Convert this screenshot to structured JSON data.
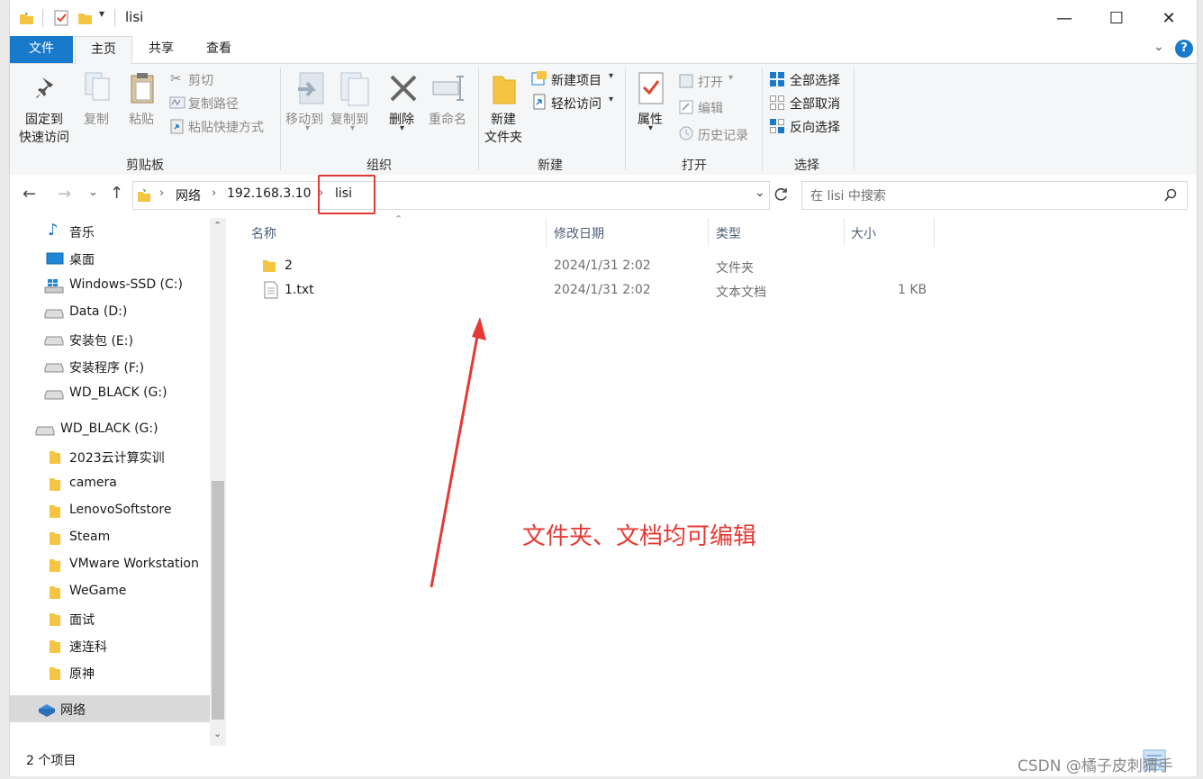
{
  "window": {
    "title": "lisi",
    "controls": {
      "minimize": "—",
      "maximize": "☐",
      "close": "✕"
    }
  },
  "ribbon_tabs": [
    "文件",
    "主页",
    "共享",
    "查看"
  ],
  "ribbon": {
    "clipboard": {
      "pin_line1": "固定到",
      "pin_line2": "快速访问",
      "copy": "复制",
      "paste": "粘贴",
      "cut": "剪切",
      "copy_path": "复制路径",
      "paste_shortcut": "粘贴快捷方式",
      "label": "剪贴板"
    },
    "organize": {
      "move_to": "移动到",
      "copy_to": "复制到",
      "delete": "删除",
      "rename": "重命名",
      "label": "组织"
    },
    "new": {
      "new_folder_line1": "新建",
      "new_folder_line2": "文件夹",
      "new_item": "新建项目",
      "easy_access": "轻松访问",
      "label": "新建"
    },
    "open": {
      "properties": "属性",
      "open": "打开",
      "edit": "编辑",
      "history": "历史记录",
      "label": "打开"
    },
    "select": {
      "select_all": "全部选择",
      "select_none": "全部取消",
      "invert": "反向选择",
      "label": "选择"
    }
  },
  "address": {
    "crumbs": [
      "网络",
      "192.168.3.10",
      "lisi"
    ],
    "search_placeholder": "在 lisi 中搜索"
  },
  "sidebar": {
    "items": [
      {
        "label": "音乐",
        "icon": "music-note-icon"
      },
      {
        "label": "桌面",
        "icon": "desktop-icon"
      },
      {
        "label": "Windows-SSD (C:)",
        "icon": "windows-drive-icon"
      },
      {
        "label": "Data (D:)",
        "icon": "drive-icon"
      },
      {
        "label": "安装包 (E:)",
        "icon": "drive-icon"
      },
      {
        "label": "安装程序 (F:)",
        "icon": "drive-icon"
      },
      {
        "label": "WD_BLACK (G:)",
        "icon": "drive-icon"
      },
      {
        "label": "WD_BLACK (G:)",
        "icon": "drive-icon"
      },
      {
        "label": "2023云计算实训",
        "icon": "folder-icon"
      },
      {
        "label": "camera",
        "icon": "folder-icon"
      },
      {
        "label": "LenovoSoftstore",
        "icon": "folder-icon"
      },
      {
        "label": "Steam",
        "icon": "folder-icon"
      },
      {
        "label": "VMware Workstation",
        "icon": "folder-icon"
      },
      {
        "label": "WeGame",
        "icon": "folder-icon"
      },
      {
        "label": "面试",
        "icon": "folder-icon"
      },
      {
        "label": "速连科",
        "icon": "folder-icon"
      },
      {
        "label": "原神",
        "icon": "folder-icon"
      },
      {
        "label": "网络",
        "icon": "network-icon"
      }
    ]
  },
  "columns": [
    "名称",
    "修改日期",
    "类型",
    "大小"
  ],
  "files": [
    {
      "name": "2",
      "date": "2024/1/31 2:02",
      "type": "文件夹",
      "size": ""
    },
    {
      "name": "1.txt",
      "date": "2024/1/31 2:02",
      "type": "文本文档",
      "size": "1 KB"
    }
  ],
  "status": {
    "count": "2 个项目"
  },
  "annotation": "文件夹、文档均可编辑",
  "watermark": "CSDN @橘子皮刺猬手",
  "colors": {
    "accent": "#1979ca",
    "annotation": "#e53935",
    "folder": "#f5c542"
  }
}
